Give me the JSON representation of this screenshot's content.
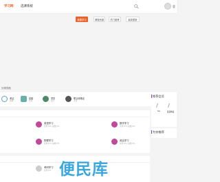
{
  "header": {
    "logo": "学习网",
    "nav_link": "选课系统",
    "user_link": "登"
  },
  "tabs": [
    {
      "label": "我要学习",
      "active": true
    },
    {
      "label": "课程资源",
      "active": false
    },
    {
      "label": "热门推荐",
      "active": false
    },
    {
      "label": "最新更新",
      "active": false
    }
  ],
  "section_label": "分类导航",
  "quick_links": [
    {
      "title": "考证",
      "sub": "资格",
      "icon": "book-icon",
      "color": "#5aa0d8"
    },
    {
      "title": "技能",
      "sub": "培训",
      "icon": "tool-icon",
      "color": "#6bb0a8"
    },
    {
      "title": "学历",
      "sub": "提升",
      "icon": "cap-icon",
      "color": "#4a8a6a"
    },
    {
      "title": "职业资格证",
      "sub": "考试",
      "icon": "person-icon",
      "color": "#555"
    }
  ],
  "panel1": {
    "items": [
      {
        "title": "英语学习",
        "meta": "文章 971 | 帖数 971",
        "color": "#c04a9a",
        "icon": "english-icon"
      },
      {
        "title": "数学学习",
        "meta": "文章 971 | 帖数 971",
        "color": "#c04a9a",
        "icon": "math-icon"
      },
      {
        "title": "物理学习",
        "meta": "文章 971 | 帖数 971",
        "color": "#c04a9a",
        "icon": "physics-icon"
      },
      {
        "title": "政治学习",
        "meta": "文章 971 | 帖数 971",
        "color": "#c04a9a",
        "icon": "politics-icon"
      }
    ]
  },
  "panel2": {
    "items": [
      {
        "title": "考研学习",
        "meta": "文章 971",
        "color": "#ccc",
        "icon": "study-icon"
      }
    ]
  },
  "side": {
    "members_title": "推荐会员",
    "members": [
      {
        "name": "Ste"
      },
      {
        "name": "爱爱精品"
      }
    ],
    "recommend_title": "为你推荐"
  },
  "watermark": "便民库"
}
